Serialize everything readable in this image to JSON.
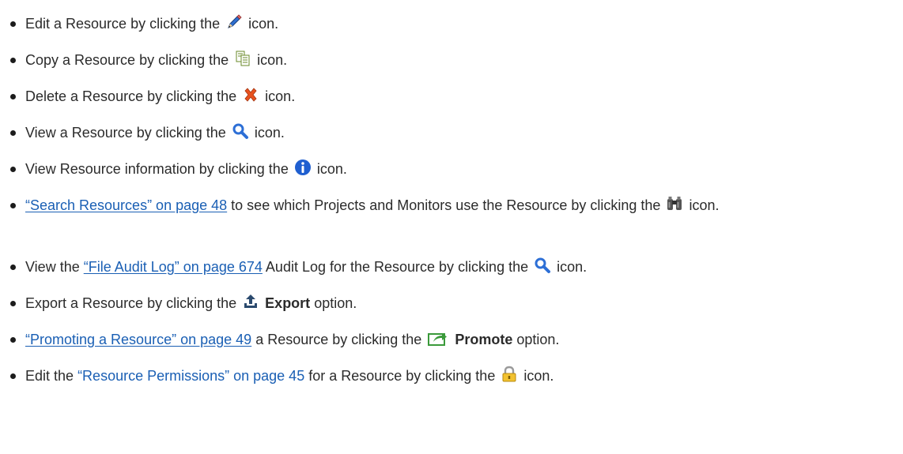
{
  "items": [
    {
      "pre": "Edit a Resource by clicking the",
      "icon": "pencil-icon",
      "post": "icon."
    },
    {
      "pre": "Copy a Resource by clicking the",
      "icon": "copy-icon",
      "post": "icon."
    },
    {
      "pre": "Delete a Resource by clicking the",
      "icon": "delete-x-icon",
      "post": "icon."
    },
    {
      "pre": "View a Resource by clicking the",
      "icon": "magnifier-icon",
      "post": "icon."
    },
    {
      "pre": "View Resource information by clicking the",
      "icon": "info-icon",
      "post": "icon."
    },
    {
      "link": "“Search Resources” on page 48",
      "pre": "to see which Projects and Monitors use the Resource by clicking the",
      "icon": "binoculars-icon",
      "post": "icon."
    },
    {
      "pre": "View the",
      "link": "“File Audit Log” on page 674",
      "mid": "Audit Log for the Resource by clicking the",
      "icon": "magnifier-icon",
      "post": "icon."
    },
    {
      "pre": "Export a Resource by clicking the",
      "icon": "export-icon",
      "bold": "Export",
      "post": "option."
    },
    {
      "link": "“Promoting a Resource” on page 49",
      "pre": "a Resource by clicking the",
      "icon": "promote-icon",
      "bold": "Promote",
      "post": "option."
    },
    {
      "pre": "Edit the",
      "link": "“Resource Permissions” on page 45",
      "mid": "for a Resource by clicking the",
      "icon": "lock-icon",
      "post": "icon."
    }
  ],
  "colors": {
    "link": "#1a5fb4",
    "text": "#2b2b2b"
  }
}
